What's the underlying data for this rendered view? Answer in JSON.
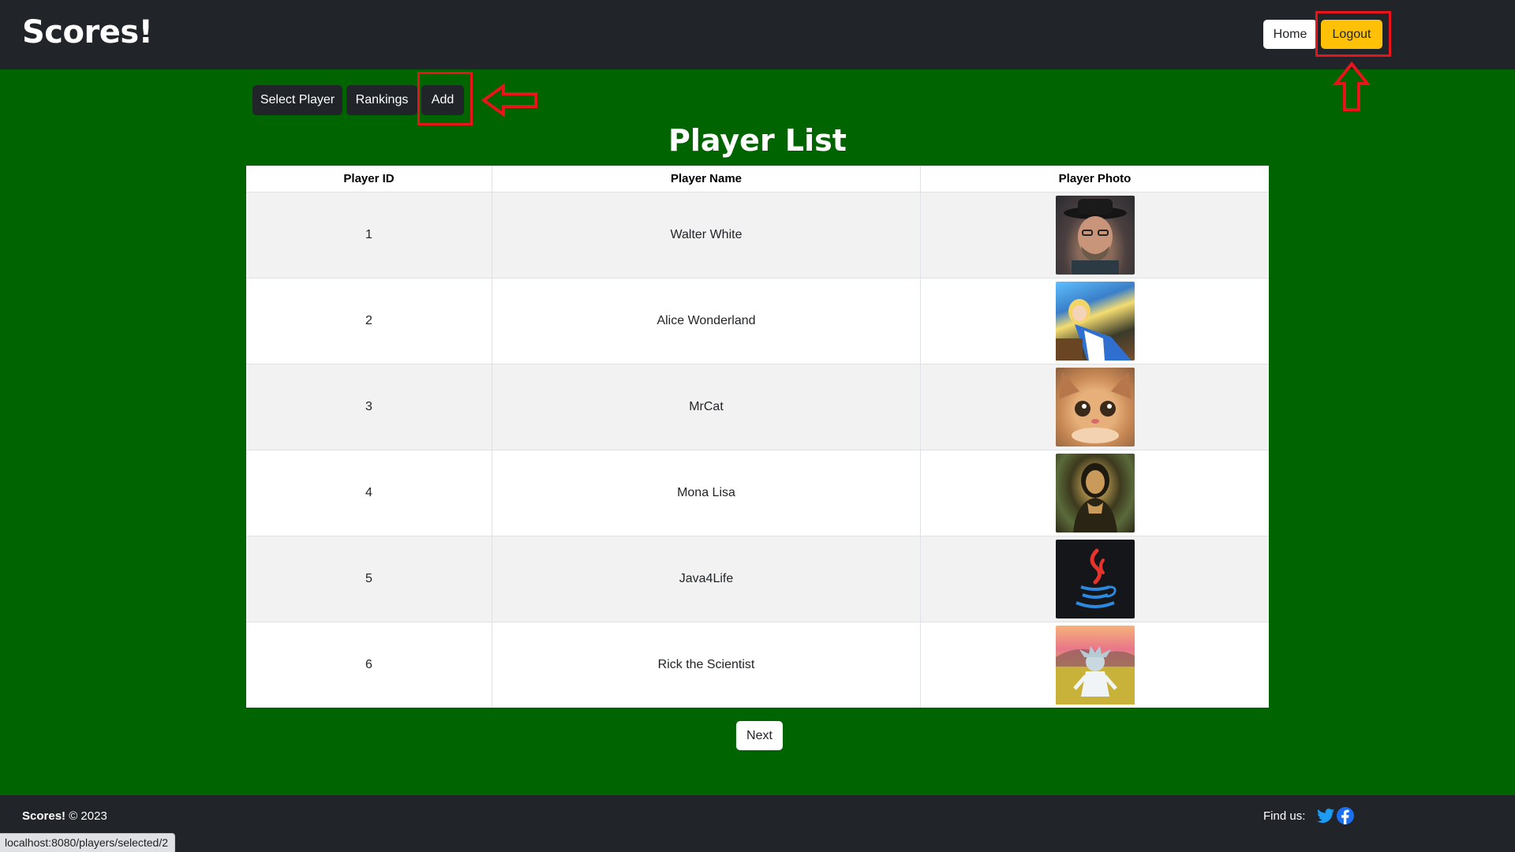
{
  "header": {
    "brand": "Scores!",
    "home_label": "Home",
    "logout_label": "Logout"
  },
  "nav": {
    "select_player": "Select Player",
    "rankings": "Rankings",
    "add": "Add"
  },
  "page_title": "Player List",
  "table": {
    "columns": [
      "Player ID",
      "Player Name",
      "Player Photo"
    ],
    "rows": [
      {
        "id": "1",
        "name": "Walter White",
        "photo_icon": "walter-white-photo"
      },
      {
        "id": "2",
        "name": "Alice Wonderland",
        "photo_icon": "alice-photo"
      },
      {
        "id": "3",
        "name": "MrCat",
        "photo_icon": "cat-photo"
      },
      {
        "id": "4",
        "name": "Mona Lisa",
        "photo_icon": "mona-lisa-photo"
      },
      {
        "id": "5",
        "name": "Java4Life",
        "photo_icon": "java-logo-photo"
      },
      {
        "id": "6",
        "name": "Rick the Scientist",
        "photo_icon": "rick-photo"
      }
    ]
  },
  "pagination": {
    "next_label": "Next"
  },
  "footer": {
    "brand": "Scores!",
    "copyright": "© 2023",
    "find_us": "Find us:",
    "social_icons": [
      "twitter-icon",
      "facebook-icon"
    ]
  },
  "status_bar": {
    "url": "localhost:8080/players/selected/2"
  },
  "colors": {
    "page_bg": "#006400",
    "header_bg": "#212529",
    "logout_bg": "#ffc107",
    "highlight": "#e8141b",
    "social_blue": "#1d9bf0"
  }
}
